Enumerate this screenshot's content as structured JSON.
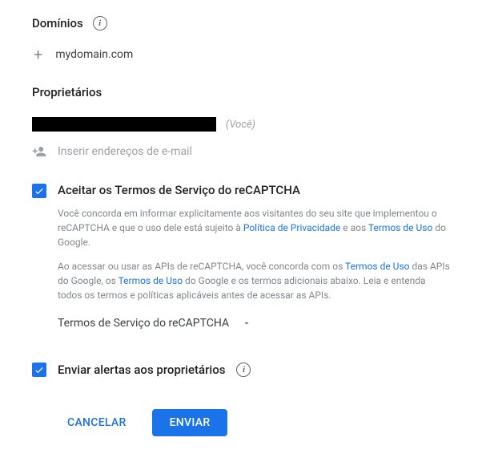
{
  "domains": {
    "header": "Domínios",
    "item": "mydomain.com"
  },
  "owners": {
    "header": "Proprietários",
    "you_label": "(Você)",
    "add_placeholder": "Inserir endereços de e-mail"
  },
  "terms": {
    "checkbox_label": "Aceitar os Termos de Serviço do reCAPTCHA",
    "para1_a": "Você concorda em informar explicitamente aos visitantes do seu site que implementou o reCAPTCHA e que o uso dele está sujeito à ",
    "privacy_link": "Política de Privacidade",
    "para1_b": " e aos ",
    "terms_link1": "Termos de Uso",
    "para1_c": " do Google.",
    "para2_a": "Ao acessar ou usar as APIs de reCAPTCHA, você concorda com os ",
    "terms_link2": "Termos de Uso",
    "para2_b": " das APIs do Google, os ",
    "terms_link3": "Termos de Uso",
    "para2_c": " do Google e os termos adicionais abaixo. Leia e entenda todos os termos e políticas aplicáveis antes de acessar as APIs.",
    "expand_label": "Termos de Serviço do reCAPTCHA"
  },
  "alerts": {
    "checkbox_label": "Enviar alertas aos proprietários"
  },
  "actions": {
    "cancel": "CANCELAR",
    "submit": "ENVIAR"
  }
}
